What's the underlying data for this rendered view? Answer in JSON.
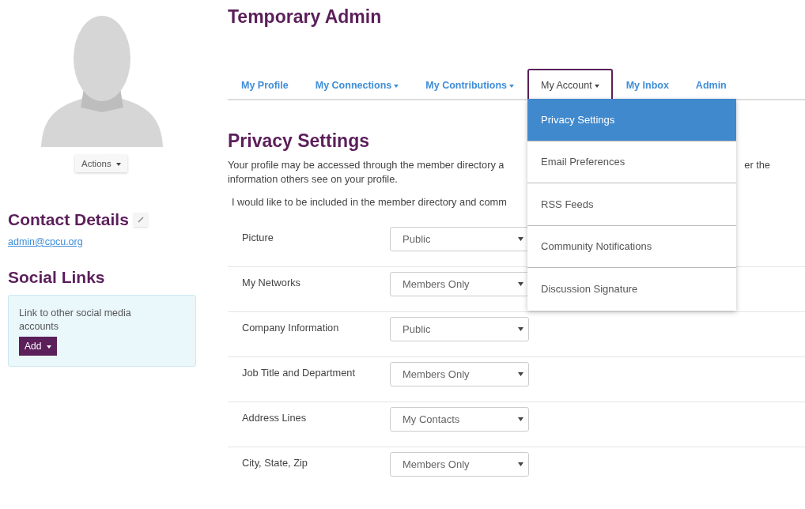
{
  "profile": {
    "actions_label": "Actions"
  },
  "contact": {
    "title": "Contact Details",
    "email": "admin@cpcu.org"
  },
  "social": {
    "title": "Social Links",
    "text": "Link to other social media accounts",
    "add_label": "Add"
  },
  "page_title": "Temporary Admin",
  "tabs": [
    {
      "label": "My Profile",
      "selected": false,
      "has_menu": false
    },
    {
      "label": "My Connections",
      "selected": false,
      "has_menu": true
    },
    {
      "label": "My Contributions",
      "selected": false,
      "has_menu": true
    },
    {
      "label": "My Account",
      "selected": true,
      "has_menu": true,
      "expanded": true
    },
    {
      "label": "My Inbox",
      "selected": false,
      "has_menu": false
    },
    {
      "label": "Admin",
      "selected": false,
      "has_menu": false
    }
  ],
  "menu": [
    {
      "label": "Privacy Settings",
      "selected": true
    },
    {
      "label": "Email Preferences",
      "selected": false
    },
    {
      "label": "RSS Feeds",
      "selected": false
    },
    {
      "label": "Community Notifications",
      "selected": false
    },
    {
      "label": "Discussion Signature",
      "selected": false
    }
  ],
  "section": {
    "title": "Privacy Settings",
    "intro_line1_start": "Your profile may be accessed through the member directory a",
    "intro_line1_end": "er the",
    "intro_line2": "information others see on your profile.",
    "directory_line": "I would like to be included in the member directory and comm"
  },
  "settings": [
    {
      "label": "Picture",
      "value": "Public"
    },
    {
      "label": "My Networks",
      "value": "Members Only"
    },
    {
      "label": "Company Information",
      "value": "Public"
    },
    {
      "label": "Job Title and Department",
      "value": "Members Only"
    },
    {
      "label": "Address Lines",
      "value": "My Contacts"
    },
    {
      "label": "City, State, Zip",
      "value": "Members Only"
    }
  ]
}
